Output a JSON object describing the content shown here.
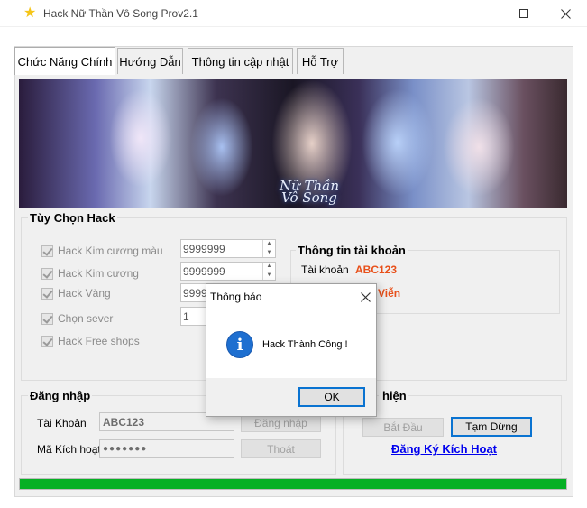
{
  "window": {
    "title": "Hack Nữ Thần Vô Song  Prov2.1",
    "app_icon": "star-icon"
  },
  "tabs": [
    {
      "label": "Chức Năng Chính",
      "active": true
    },
    {
      "label": "Hướng Dẫn",
      "active": false
    },
    {
      "label": "Thông tin cập nhật",
      "active": false
    },
    {
      "label": "Hỗ Trợ",
      "active": false
    }
  ],
  "banner": {
    "logo_line1": "Nữ Thần",
    "logo_line2": "Vô Song"
  },
  "hack_options": {
    "group_title": "Tùy Chọn Hack",
    "items": [
      {
        "label": "Hack Kim cương màu",
        "value": "9999999",
        "checked": true
      },
      {
        "label": "Hack Kim cương",
        "value": "9999999",
        "checked": true
      },
      {
        "label": "Hack Vàng",
        "value": "9999",
        "checked": true
      },
      {
        "label": "Chọn sever",
        "value": "1",
        "checked": true
      },
      {
        "label": "Hack Free shops",
        "checked": true
      }
    ]
  },
  "account_info": {
    "group_title": "Thông tin tài khoản",
    "account_label": "Tài khoản",
    "account_value": "ABC123",
    "rank_value_partial": "Viễn"
  },
  "login": {
    "group_title": "Đăng nhập",
    "account_label": "Tài Khoản",
    "account_value": "ABC123",
    "code_label": "Mã Kích hoạt",
    "code_value": "●●●●●●●",
    "login_button": "Đăng nhập",
    "exit_button": "Thoát"
  },
  "execute": {
    "group_title_partial": "hiện",
    "start_button": "Bắt Đầu",
    "pause_button": "Tạm Dừng",
    "register_link": "Đăng Ký Kích Hoạt"
  },
  "progress": {
    "percent": 100,
    "color": "#06b025"
  },
  "dialog": {
    "title": "Thông báo",
    "message": "Hack Thành Công !",
    "ok_button": "OK",
    "icon": "info-icon"
  }
}
